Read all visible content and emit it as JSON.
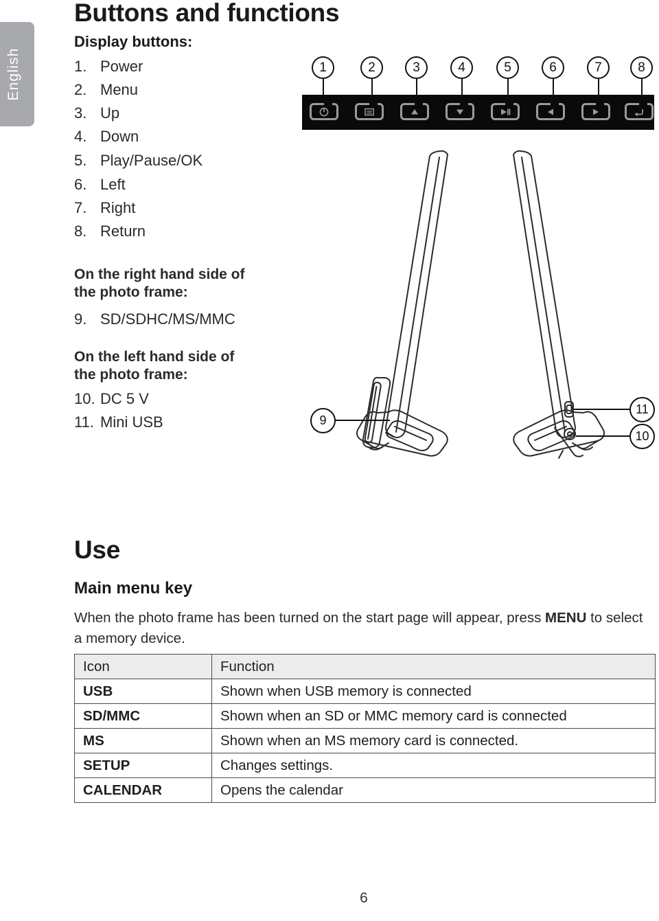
{
  "language_tab": {
    "label": "English"
  },
  "page_title": "Buttons and functions",
  "display_buttons": {
    "heading": "Display buttons:",
    "items": [
      {
        "index": "1.",
        "label": "Power"
      },
      {
        "index": "2.",
        "label": "Menu"
      },
      {
        "index": "3.",
        "label": "Up"
      },
      {
        "index": "4.",
        "label": "Down"
      },
      {
        "index": "5.",
        "label": "Play/Pause/OK"
      },
      {
        "index": "6.",
        "label": "Left"
      },
      {
        "index": "7.",
        "label": "Right"
      },
      {
        "index": "8.",
        "label": "Return"
      }
    ]
  },
  "right_side": {
    "heading_line1": "On the right hand side of",
    "heading_line2": "the photo frame:",
    "items": [
      {
        "index": "9.",
        "label": "SD/SDHC/MS/MMC"
      }
    ]
  },
  "left_side": {
    "heading_line1": "On the left hand side of",
    "heading_line2": "the photo frame:",
    "items": [
      {
        "index": "10.",
        "label": "DC 5 V"
      },
      {
        "index": "11.",
        "label": "Mini USB"
      }
    ]
  },
  "button_bar": {
    "callouts": [
      "1",
      "2",
      "3",
      "4",
      "5",
      "6",
      "7",
      "8"
    ],
    "keys": [
      {
        "callout": "1",
        "icon": "power-icon"
      },
      {
        "callout": "2",
        "icon": "menu-icon"
      },
      {
        "callout": "3",
        "icon": "up-arrow-icon"
      },
      {
        "callout": "4",
        "icon": "down-arrow-icon"
      },
      {
        "callout": "5",
        "icon": "play-pause-icon"
      },
      {
        "callout": "6",
        "icon": "left-arrow-icon"
      },
      {
        "callout": "7",
        "icon": "right-arrow-icon"
      },
      {
        "callout": "8",
        "icon": "return-icon"
      }
    ],
    "bar_color": "#0a0a0a",
    "key_outline_color": "#9b9b9b"
  },
  "frame_illustration": {
    "callouts": [
      {
        "number": "9",
        "side": "left"
      },
      {
        "number": "11",
        "side": "right"
      },
      {
        "number": "10",
        "side": "right"
      }
    ]
  },
  "use_section": {
    "heading": "Use",
    "subheading": "Main menu key",
    "paragraph_part1": "When the photo frame has been turned on the start page will appear, press ",
    "paragraph_bold": "MENU",
    "paragraph_part2": " to select a memory device."
  },
  "table": {
    "headers": [
      "Icon",
      "Function"
    ],
    "rows": [
      {
        "icon": "USB",
        "function": "Shown when USB memory is connected"
      },
      {
        "icon": "SD/MMC",
        "function": "Shown when an SD or MMC memory card is connected"
      },
      {
        "icon": "MS",
        "function": "Shown when an MS memory card is connected."
      },
      {
        "icon": "SETUP",
        "function": "Changes settings."
      },
      {
        "icon": "CALENDAR",
        "function": "Opens the calendar"
      }
    ]
  },
  "page_number": "6"
}
